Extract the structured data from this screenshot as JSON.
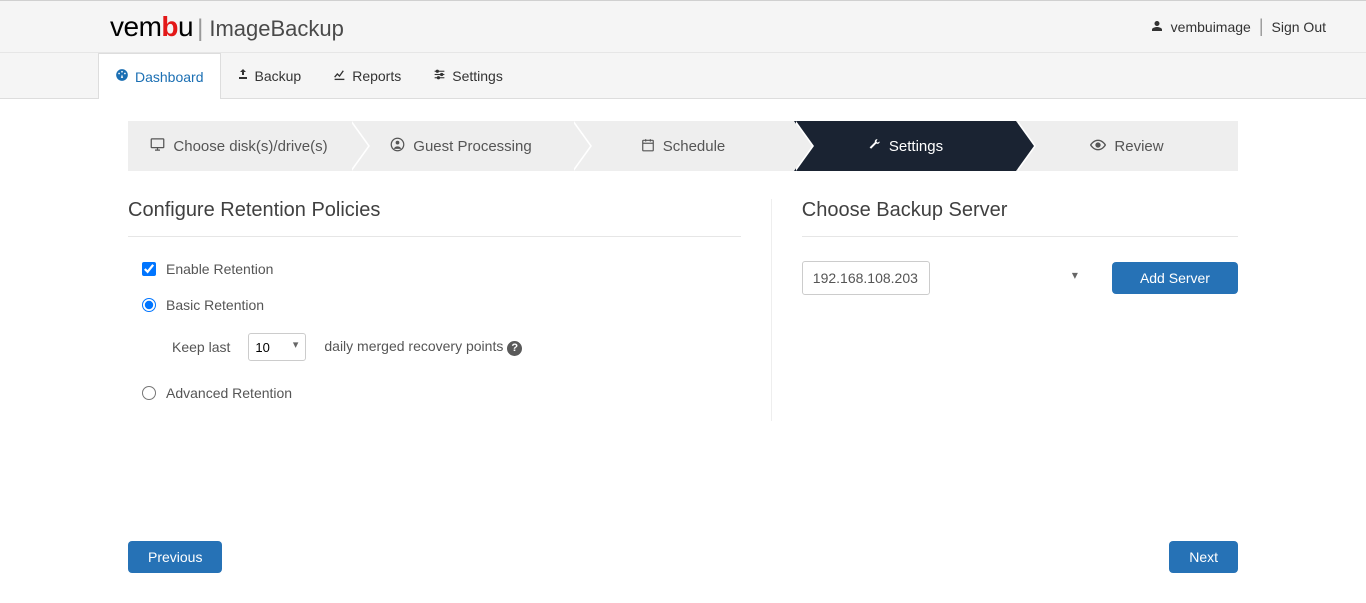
{
  "header": {
    "brand_a": "vem",
    "brand_b": "b",
    "brand_c": "u",
    "product": "ImageBackup",
    "user_name": "vembuimage",
    "sign_out": "Sign Out"
  },
  "nav": {
    "dashboard": "Dashboard",
    "backup": "Backup",
    "reports": "Reports",
    "settings": "Settings"
  },
  "wizard": {
    "step1": "Choose disk(s)/drive(s)",
    "step2": "Guest Processing",
    "step3": "Schedule",
    "step4": "Settings",
    "step5": "Review"
  },
  "retention": {
    "title": "Configure Retention Policies",
    "enable_label": "Enable Retention",
    "basic_label": "Basic Retention",
    "keep_last_label": "Keep last",
    "keep_last_value": "10",
    "keep_last_suffix": "daily merged recovery points",
    "advanced_label": "Advanced Retention"
  },
  "server": {
    "title": "Choose Backup Server",
    "selected": "192.168.108.203",
    "add_button": "Add Server"
  },
  "footer": {
    "previous": "Previous",
    "next": "Next"
  }
}
